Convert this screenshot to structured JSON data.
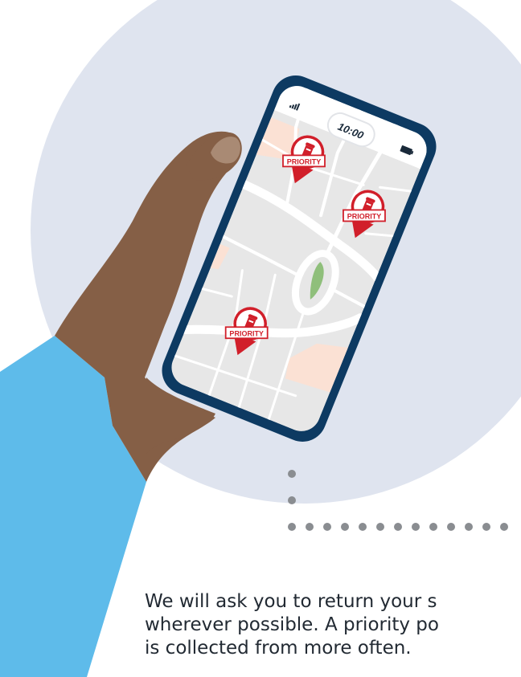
{
  "phone": {
    "time": "10:00",
    "pin_label": "PRIORITY"
  },
  "caption": {
    "lines": [
      "We will ask you to return your s",
      "wherever possible. A priority po",
      "is collected from more often."
    ]
  },
  "colors": {
    "background_circle": "#dfe4ef",
    "sleeve": "#5ebbea",
    "skin": "#855f46",
    "phone_frame": "#0d3a62",
    "map_background": "#e7e7e7",
    "map_roads": "#ffffff",
    "park": "#8fbf7b",
    "accent_area": "#fbe1d4",
    "pin_red": "#d11f2a",
    "dots": "#8a8d91",
    "text": "#222a33"
  }
}
